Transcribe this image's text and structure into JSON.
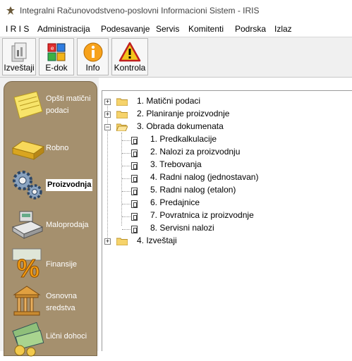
{
  "window": {
    "title": "Integralni Računovodstveno-poslovni Informacioni Sistem - IRIS"
  },
  "menubar": {
    "items": [
      "I R I S",
      "Administracija",
      "Podesavanje",
      "Servis",
      "Komitenti",
      "Podrska",
      "Izlaz"
    ]
  },
  "toolbar": {
    "buttons": [
      {
        "label": "Izveštaji",
        "icon": "reports-icon"
      },
      {
        "label": "E-dok",
        "icon": "e-documents-icon"
      },
      {
        "label": "Info",
        "icon": "info-icon"
      },
      {
        "label": "Kontrola",
        "icon": "warning-icon"
      }
    ]
  },
  "sidebar": {
    "items": [
      {
        "label_line1": "Opšti matični",
        "label_line2": "podaci",
        "icon": "notepad-icon"
      },
      {
        "label_line1": "Robno",
        "icon": "gold-bar-icon"
      },
      {
        "label_line1": "Proizvodnja",
        "icon": "gears-icon",
        "active": true
      },
      {
        "label_line1": "Maloprodaja",
        "icon": "cash-register-icon"
      },
      {
        "label_line1": "Finansije",
        "icon": "percent-icon"
      },
      {
        "label_line1": "Osnovna",
        "label_line2": "sredstva",
        "icon": "building-icon"
      },
      {
        "label_line1": "Lični dohoci",
        "icon": "money-icon"
      }
    ]
  },
  "tree": {
    "nodes": [
      {
        "label": "1. Matični podaci",
        "expander": "+"
      },
      {
        "label": "2. Planiranje proizvodnje",
        "expander": "+"
      },
      {
        "label": "3. Obrada dokumenata",
        "expander": "−"
      },
      {
        "label": "1. Predkalkulacije"
      },
      {
        "label": "2. Nalozi za proizvodnju"
      },
      {
        "label": "3. Trebovanja"
      },
      {
        "label": "4. Radni nalog (jednostavan)"
      },
      {
        "label": "5. Radni nalog (etalon)"
      },
      {
        "label": "6. Predajnice"
      },
      {
        "label": "7. Povratnica iz proizvodnje"
      },
      {
        "label": "8. Servisni nalozi"
      },
      {
        "label": "4. Izveštaji",
        "expander": "+"
      }
    ]
  }
}
